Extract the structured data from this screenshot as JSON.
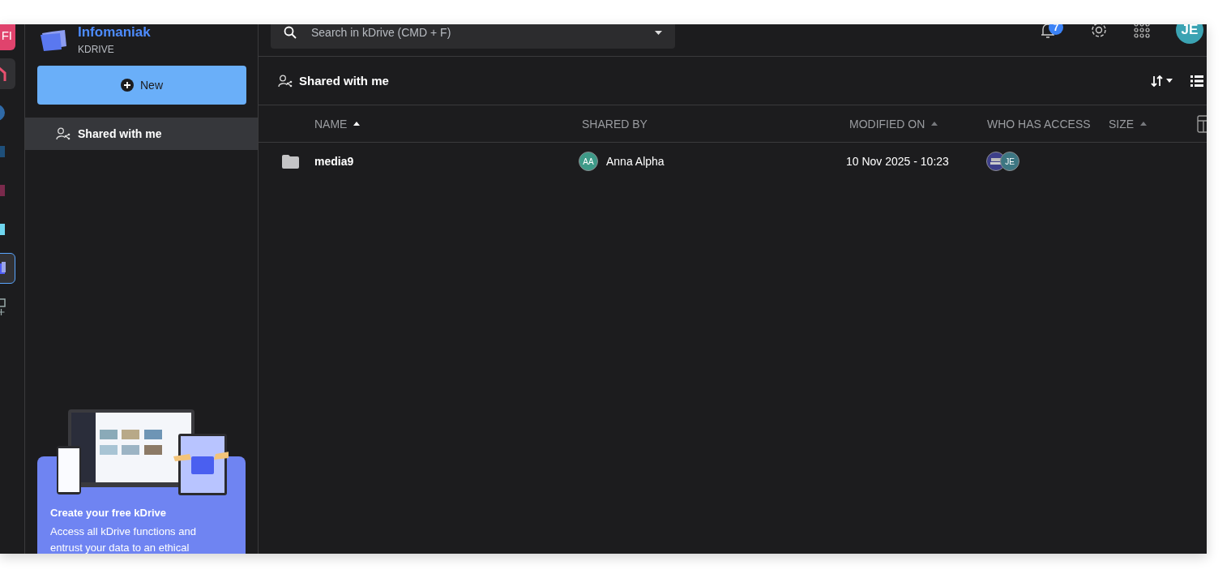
{
  "app_rail": {
    "items": [
      {
        "kind": "badge",
        "label": "FI",
        "selected": false
      },
      {
        "kind": "home",
        "selected": false
      },
      {
        "kind": "sphere",
        "selected": false
      },
      {
        "kind": "cube-navy",
        "selected": false
      },
      {
        "kind": "cube-wine",
        "selected": false
      },
      {
        "kind": "cube-cyan",
        "selected": false
      },
      {
        "kind": "drive",
        "selected": true
      },
      {
        "kind": "add",
        "selected": false
      }
    ]
  },
  "sidebar": {
    "brand": {
      "name": "Infomaniak",
      "product": "KDRIVE"
    },
    "new_button": "New",
    "items": [
      {
        "label": "Shared with me",
        "selected": true
      }
    ],
    "promo": {
      "title": "Create your free kDrive",
      "text": "Access all kDrive functions and entrust your data to an ethical"
    }
  },
  "topbar": {
    "search": {
      "placeholder": "Search in kDrive (CMD + F)"
    },
    "notifications": "7",
    "avatar": "JE"
  },
  "page_title": "Shared with me",
  "table": {
    "columns": [
      {
        "label": "NAME",
        "sortable": true,
        "sorted": true
      },
      {
        "label": "SHARED BY",
        "sortable": false
      },
      {
        "label": "MODIFIED ON",
        "sortable": true,
        "sorted": false
      },
      {
        "label": "WHO HAS ACCESS",
        "sortable": false
      },
      {
        "label": "SIZE",
        "sortable": true,
        "sorted": false
      }
    ],
    "rows": [
      {
        "name": "media9",
        "shared_by": {
          "initials": "AA",
          "name": "Anna Alpha"
        },
        "modified": "10 Nov 2025 - 10:23",
        "access": [
          {
            "kind": "image"
          },
          {
            "kind": "initials",
            "initials": "JE"
          }
        ]
      }
    ]
  }
}
